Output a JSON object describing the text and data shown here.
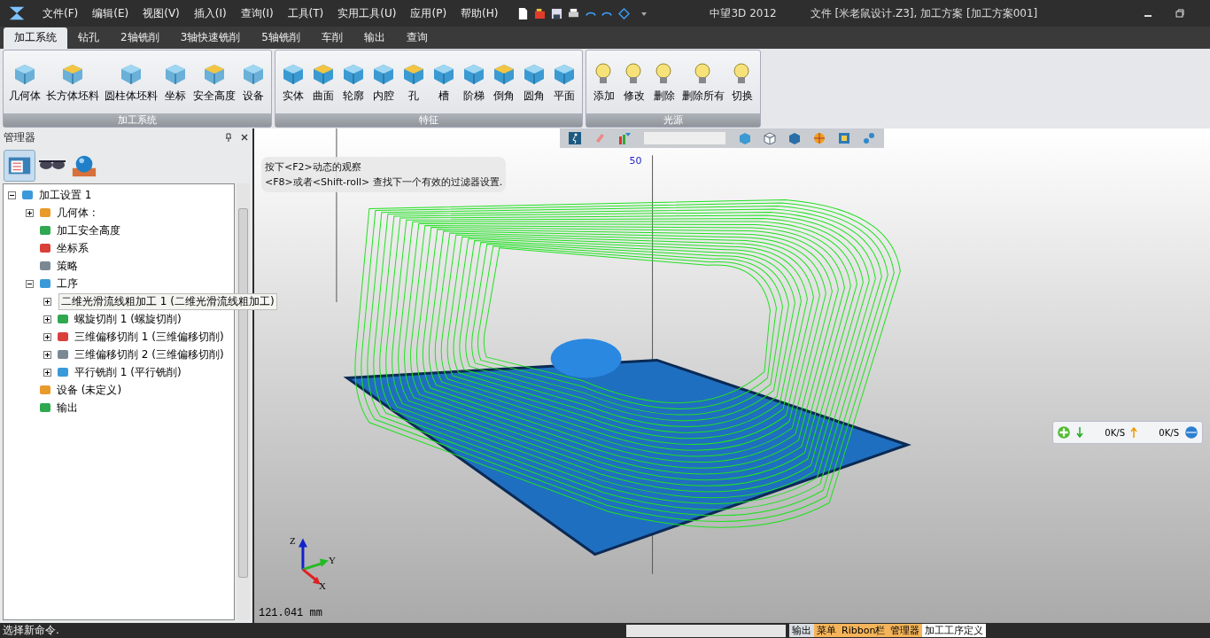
{
  "menu": [
    "文件(F)",
    "编辑(E)",
    "视图(V)",
    "插入(I)",
    "查询(I)",
    "工具(T)",
    "实用工具(U)",
    "应用(P)",
    "帮助(H)"
  ],
  "window": {
    "app": "中望3D 2012",
    "title": "文件 [米老鼠设计.Z3], 加工方案 [加工方案001]"
  },
  "tabs": [
    {
      "label": "加工系统",
      "selected": true
    },
    {
      "label": "钻孔",
      "selected": false
    },
    {
      "label": "2轴铣削",
      "selected": false
    },
    {
      "label": "3轴快速铣削",
      "selected": false
    },
    {
      "label": "5轴铣削",
      "selected": false
    },
    {
      "label": "车削",
      "selected": false
    },
    {
      "label": "输出",
      "selected": false
    },
    {
      "label": "查询",
      "selected": false
    }
  ],
  "ribbon_groups": [
    {
      "title": "加工系统",
      "buttons": [
        "几何体",
        "长方体坯料",
        "圆柱体坯料",
        "坐标",
        "安全高度",
        "设备"
      ]
    },
    {
      "title": "特征",
      "buttons": [
        "实体",
        "曲面",
        "轮廓",
        "内腔",
        "孔",
        "槽",
        "阶梯",
        "倒角",
        "圆角",
        "平面"
      ]
    },
    {
      "title": "光源",
      "buttons": [
        "添加",
        "修改",
        "删除",
        "删除所有",
        "切换"
      ]
    }
  ],
  "manager": {
    "title": "管理器",
    "panel_tabs": [
      {
        "selected": true
      },
      {
        "selected": false
      },
      {
        "selected": false
      }
    ],
    "tree": [
      {
        "label": "加工设置 1",
        "expanded": true,
        "children": [
          {
            "label": "几何体 :",
            "expanded": false
          },
          {
            "label": "加工安全高度"
          },
          {
            "label": "坐标系"
          },
          {
            "label": "策略"
          },
          {
            "label": "工序",
            "expanded": true,
            "children": [
              {
                "label": "二维光滑流线粗加工 1 (二维光滑流线粗加工)",
                "expanded": false,
                "highlighted": true
              },
              {
                "label": "螺旋切削 1 (螺旋切削)",
                "expanded": false,
                "highlighted": false
              },
              {
                "label": "三维偏移切削 1 (三维偏移切削)",
                "expanded": false,
                "highlighted": false
              },
              {
                "label": "三维偏移切削 2 (三维偏移切削)",
                "expanded": false,
                "highlighted": false
              },
              {
                "label": "平行铣削 1 (平行铣削)",
                "expanded": false,
                "highlighted": false
              }
            ]
          },
          {
            "label": "设备 (未定义)"
          },
          {
            "label": "输出"
          }
        ]
      }
    ]
  },
  "viewport": {
    "hint": [
      "按下<F2>动态的观察",
      "<F8>或者<Shift-roll> 查找下一个有效的过滤器设置."
    ],
    "dimension": "50",
    "axes": [
      "Z",
      "Y",
      "X"
    ],
    "scale": "121.041 mm"
  },
  "network": {
    "down": "0K/S",
    "up": "0K/S"
  },
  "status_bar": {
    "message": "选择新命令.",
    "tabs": [
      "输出",
      "菜单",
      "Ribbon栏",
      "管理器",
      "加工工序定义"
    ]
  }
}
